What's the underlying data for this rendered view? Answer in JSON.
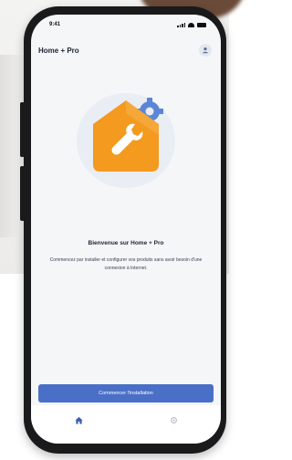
{
  "status_bar": {
    "time": "9:41"
  },
  "header": {
    "title": "Home + Pro",
    "account_icon": "person-icon"
  },
  "welcome": {
    "title": "Bienvenue sur Home + Pro",
    "text": "Commencez par installer et configurer vos produits sans avoir besoin d'une connexion à Internet."
  },
  "cta": {
    "label": "Commencer l'installation"
  },
  "tabs": [
    {
      "name": "home",
      "icon": "home-icon",
      "active": true
    },
    {
      "name": "settings",
      "icon": "gear-icon",
      "active": false
    }
  ],
  "colors": {
    "accent": "#4a6fc7",
    "house_orange": "#f39a1f",
    "gear_blue": "#5b85d6",
    "tab_active": "#3d5fb3",
    "tab_inactive": "#b8bfcc"
  }
}
